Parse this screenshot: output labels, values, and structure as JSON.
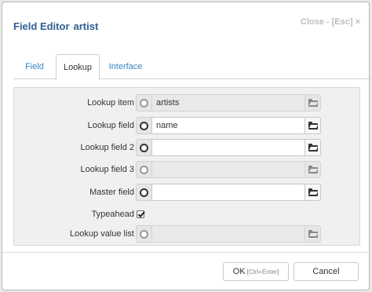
{
  "dialog": {
    "title": "Field Editor",
    "field_name": "artist",
    "close_label": "Close - [Esc] ×"
  },
  "tabs": [
    {
      "label": "Field",
      "active": false
    },
    {
      "label": "Lookup",
      "active": true
    },
    {
      "label": "Interface",
      "active": false
    }
  ],
  "lookup": {
    "rows": [
      {
        "label": "Lookup item",
        "value": "artists",
        "enabled": false
      },
      {
        "label": "Lookup field",
        "value": "name",
        "enabled": true
      },
      {
        "label": "Lookup field 2",
        "value": "",
        "enabled": true
      },
      {
        "label": "Lookup field 3",
        "value": "",
        "enabled": false
      },
      {
        "label": "Master field",
        "value": "",
        "enabled": true
      }
    ],
    "typeahead": {
      "label": "Typeahead",
      "checked": true
    },
    "lookup_value_list": {
      "label": "Lookup value list",
      "value": "",
      "enabled": false
    }
  },
  "footer": {
    "ok_label": "OK",
    "ok_hint": "[Ctrl+Enter]",
    "cancel_label": "Cancel"
  }
}
